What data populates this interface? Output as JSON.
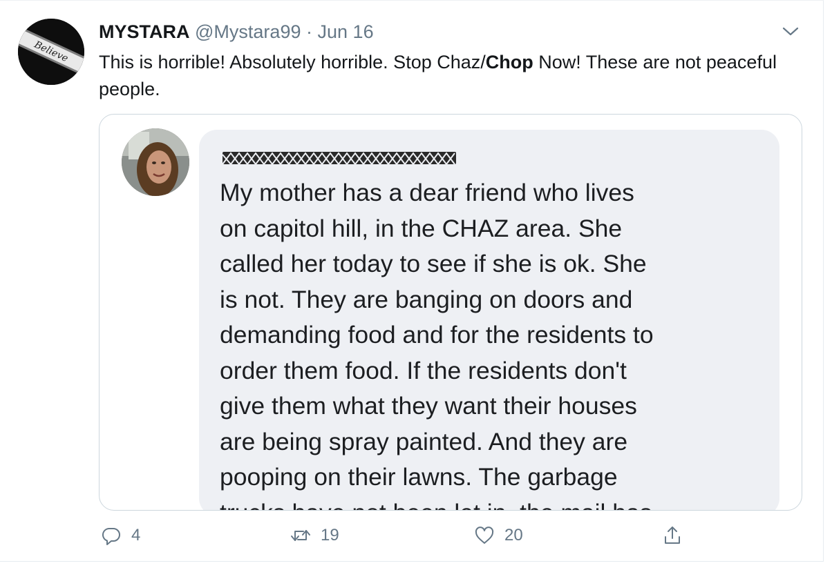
{
  "tweet": {
    "author_name": "MYSTARA",
    "author_handle": "@Mystara99",
    "separator": "·",
    "date": "Jun 16",
    "avatar_text": "Believe",
    "text_before": "This is horrible! Absolutely horrible. Stop Chaz/",
    "text_bold": "Chop",
    "text_after": " Now! These are not peaceful people."
  },
  "embedded_post": {
    "lines": [
      "My mother has a dear friend who lives",
      "on capitol hill, in the CHAZ area. She",
      "called her today to see if she is ok. She",
      "is not. They are banging on doors and",
      "demanding food and for the residents to",
      "order them food. If the residents don't",
      "give them what they want their houses",
      "are being spray painted. And they are",
      "pooping on their lawns. The garbage",
      "trucks have not been let in, the mail has"
    ]
  },
  "actions": {
    "reply_count": "4",
    "retweet_count": "19",
    "like_count": "20"
  },
  "icons": {
    "reply": "reply-icon",
    "retweet": "retweet-icon",
    "like": "heart-icon",
    "share": "share-icon",
    "more": "chevron-down-icon"
  },
  "colors": {
    "muted": "#657786",
    "text": "#14171a",
    "border": "#ccd6dd",
    "bubble": "#eef0f4"
  }
}
